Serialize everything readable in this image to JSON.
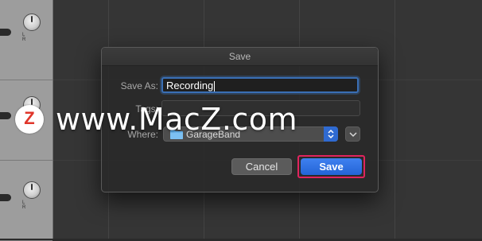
{
  "background": {
    "tracks": [
      {
        "pan_labels": "L R"
      },
      {
        "pan_labels": "L R"
      },
      {
        "pan_labels": "L R"
      }
    ]
  },
  "watermark": {
    "logo_letter": "Z",
    "text": "www.MacZ.com"
  },
  "dialog": {
    "title": "Save",
    "save_as_label": "Save As:",
    "save_as_value": "Recording",
    "tags_label": "Tags:",
    "tags_value": "",
    "where_label": "Where:",
    "where_value": "GarageBand",
    "cancel_label": "Cancel",
    "save_label": "Save"
  },
  "colors": {
    "accent_blue": "#2f6ad1",
    "highlight_pink": "#e0245e",
    "folder_blue": "#5aa9e6"
  },
  "icons": {
    "folder": "folder-icon",
    "select_arrows": "updown-chevron-icon",
    "expand": "chevron-down-icon"
  }
}
